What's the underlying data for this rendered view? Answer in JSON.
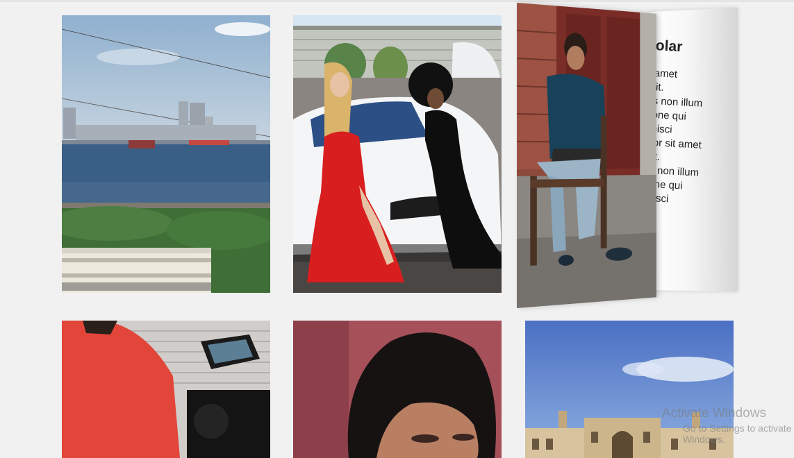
{
  "back_card": {
    "title": "olar",
    "lines": [
      "amet",
      "lit.",
      "s non illum",
      "one qui",
      "bisci",
      "lor sit amet",
      "lit.",
      "s non illum",
      "one qui",
      "bisci"
    ]
  },
  "watermark": {
    "title": "Activate Windows",
    "subtitle": "Go to Settings to activate Windows."
  },
  "colors": {
    "page_background": "#f1f1f1",
    "red_dress": "#d81e1e",
    "sea": "#3a5f86"
  }
}
